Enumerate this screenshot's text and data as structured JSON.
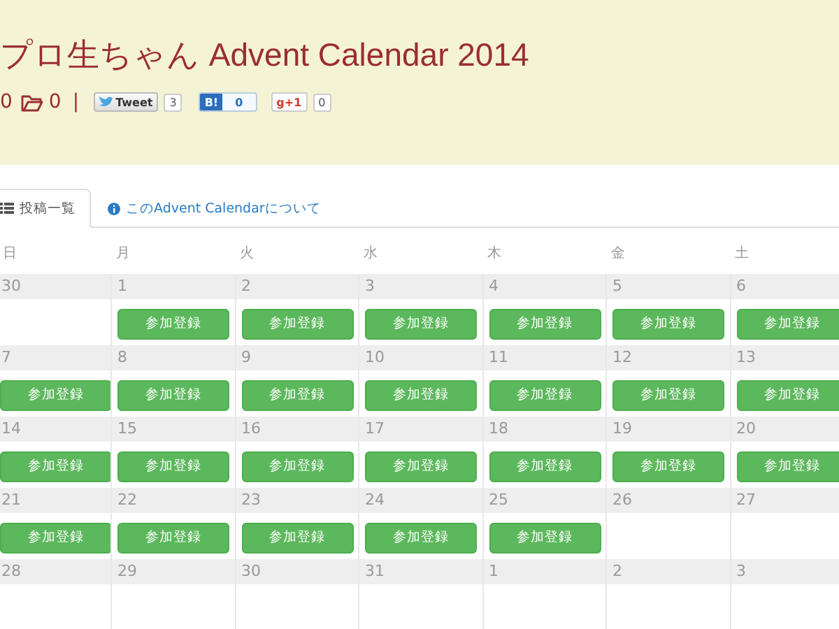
{
  "header": {
    "title": "プロ生ちゃん Advent Calendar 2014",
    "counts": [
      {
        "kind": "likes",
        "value": "0"
      },
      {
        "kind": "folders",
        "value": "0"
      }
    ],
    "separator": "|",
    "share": [
      {
        "kind": "tweet",
        "label": "Tweet",
        "count": "3"
      },
      {
        "kind": "hatena",
        "label": "B!",
        "count": "0"
      },
      {
        "kind": "gplus",
        "label": "g+1",
        "count": "0"
      }
    ]
  },
  "tabs": [
    {
      "kind": "list",
      "label": "投稿一覧",
      "selected": true
    },
    {
      "kind": "info",
      "label": "このAdvent Calendarについて",
      "selected": false
    }
  ],
  "calendar": {
    "weekdays": [
      "日",
      "月",
      "火",
      "水",
      "木",
      "金",
      "土"
    ],
    "weeks": [
      [
        {
          "day": "30"
        },
        {
          "day": "1",
          "button": "参加登録"
        },
        {
          "day": "2",
          "button": "参加登録"
        },
        {
          "day": "3",
          "button": "参加登録"
        },
        {
          "day": "4",
          "button": "参加登録"
        },
        {
          "day": "5",
          "button": "参加登録"
        },
        {
          "day": "6",
          "button": "参加登録"
        }
      ],
      [
        {
          "day": "7",
          "button": "参加登録"
        },
        {
          "day": "8",
          "button": "参加登録"
        },
        {
          "day": "9",
          "button": "参加登録"
        },
        {
          "day": "10",
          "button": "参加登録"
        },
        {
          "day": "11",
          "button": "参加登録"
        },
        {
          "day": "12",
          "button": "参加登録"
        },
        {
          "day": "13",
          "button": "参加登録"
        }
      ],
      [
        {
          "day": "14",
          "button": "参加登録"
        },
        {
          "day": "15",
          "button": "参加登録"
        },
        {
          "day": "16",
          "button": "参加登録"
        },
        {
          "day": "17",
          "button": "参加登録"
        },
        {
          "day": "18",
          "button": "参加登録"
        },
        {
          "day": "19",
          "button": "参加登録"
        },
        {
          "day": "20",
          "button": "参加登録"
        }
      ],
      [
        {
          "day": "21",
          "button": "参加登録"
        },
        {
          "day": "22",
          "button": "参加登録"
        },
        {
          "day": "23",
          "button": "参加登録"
        },
        {
          "day": "24",
          "button": "参加登録"
        },
        {
          "day": "25",
          "button": "参加登録"
        },
        {
          "day": "26"
        },
        {
          "day": "27"
        }
      ],
      [
        {
          "day": "28"
        },
        {
          "day": "29"
        },
        {
          "day": "30"
        },
        {
          "day": "31"
        },
        {
          "day": "1"
        },
        {
          "day": "2"
        },
        {
          "day": "3"
        }
      ]
    ]
  }
}
